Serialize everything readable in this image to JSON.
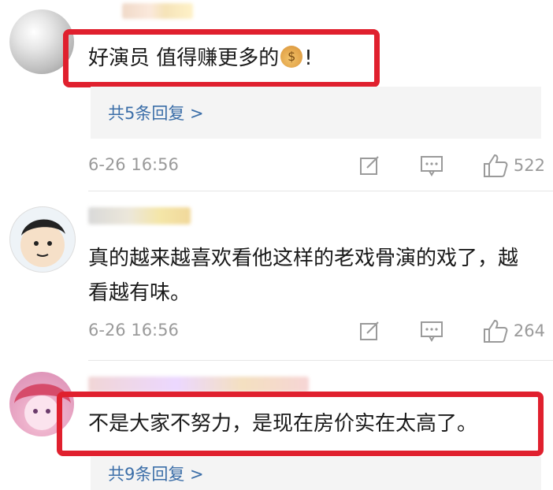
{
  "comments": [
    {
      "text": "好演员 值得赚更多的",
      "emoji": "money-bag-icon",
      "emoji_glyph": "$",
      "suffix": "!",
      "reply_count_label": "共5条回复 >",
      "time": "6-26 16:56",
      "likes": "522"
    },
    {
      "text": "真的越来越喜欢看他这样的老戏骨演的戏了，越看越有味。",
      "time": "6-26 16:56",
      "likes": "264"
    },
    {
      "text": "不是大家不努力，是现在房价实在太高了。",
      "reply_count_label": "共9条回复 >"
    }
  ],
  "colors": {
    "highlight": "#e0202e",
    "link": "#3b6ea8",
    "meta": "#9a9a9a"
  }
}
